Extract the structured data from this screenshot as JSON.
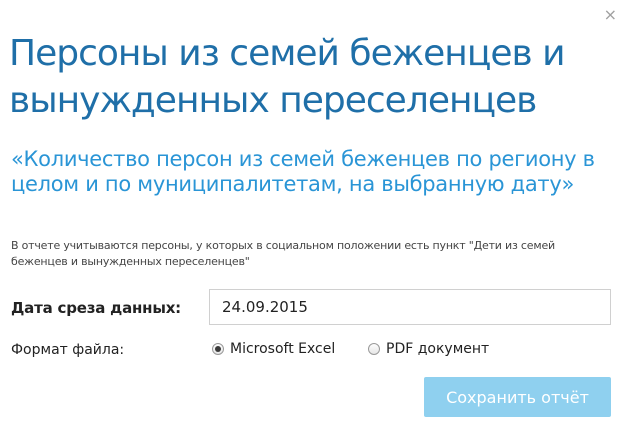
{
  "dialog": {
    "close_glyph": "×",
    "title": "Персоны из семей беженцев и вынужденных переселенцев",
    "subtitle": "«Количество персон из семей беженцев по региону в целом и по муниципалитетам, на выбранную дату»",
    "note": "В отчете учитываются персоны, у которых в социальном положении есть пункт \"Дети из семей беженцев и вынужденных переселенцев\""
  },
  "form": {
    "date_label": "Дата среза данных:",
    "date_value": "24.09.2015",
    "format_label": "Формат файла:",
    "format_options": [
      {
        "label": "Microsoft Excel",
        "checked": true
      },
      {
        "label": "PDF документ",
        "checked": false
      }
    ]
  },
  "actions": {
    "save_label": "Сохранить отчёт"
  },
  "colors": {
    "title": "#1f6fa8",
    "subtitle": "#2a95d6",
    "save_button": "#8fd0ef"
  }
}
